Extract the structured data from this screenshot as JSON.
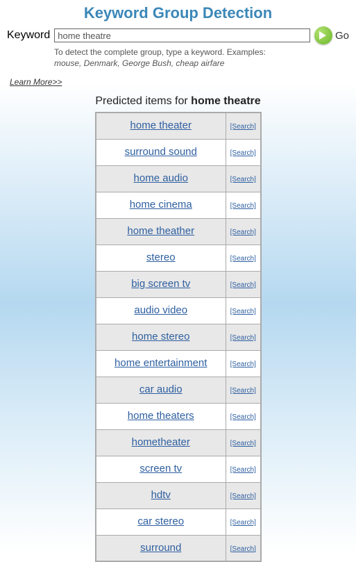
{
  "title": "Keyword Group Detection",
  "search": {
    "label": "Keyword",
    "value": "home theatre",
    "go_label": "Go"
  },
  "hint": {
    "line1": "To detect the complete group, type a keyword. Examples:",
    "line2": "mouse, Denmark, George Bush, cheap airfare"
  },
  "learn_more": "Learn More>>",
  "results": {
    "prefix": "Predicted items for ",
    "query": "home theatre",
    "search_link_label": "[Search]",
    "items": [
      "home theater",
      "surround sound",
      "home audio",
      "home cinema",
      "home theather",
      "stereo",
      "big screen tv",
      "audio video",
      "home stereo",
      "home entertainment",
      "car audio",
      "home theaters",
      "hometheater",
      "screen tv",
      "hdtv",
      "car stereo",
      "surround"
    ]
  }
}
